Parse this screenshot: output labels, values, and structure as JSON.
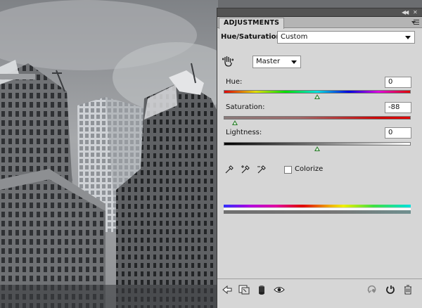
{
  "panel": {
    "tab_label": "ADJUSTMENTS",
    "menu_icon": "panel-menu-icon",
    "collapse_icon": "double-chevron-icon",
    "close_icon": "close-icon"
  },
  "adjustment": {
    "title": "Hue/Saturation",
    "preset": "Custom",
    "channel": "Master"
  },
  "sliders": {
    "hue": {
      "label": "Hue:",
      "value": "0",
      "level": 0.5
    },
    "saturation": {
      "label": "Saturation:",
      "value": "-88",
      "level": 0.06
    },
    "lightness": {
      "label": "Lightness:",
      "value": "0",
      "level": 0.5
    }
  },
  "colorize": {
    "label": "Colorize",
    "checked": false
  },
  "tools": [
    "eyedropper-icon",
    "eyedropper-plus-icon",
    "eyedropper-minus-icon"
  ],
  "bottom_bar": {
    "left_icons": [
      "back-arrow-icon",
      "clip-to-layer-icon",
      "visibility-mask-icon",
      "eye-icon"
    ],
    "right_icons": [
      "previous-state-icon",
      "reset-icon",
      "trash-icon"
    ]
  },
  "colors": {
    "panel_bg": "#d6d6d6",
    "thumb_green": "#2b7a2b"
  }
}
